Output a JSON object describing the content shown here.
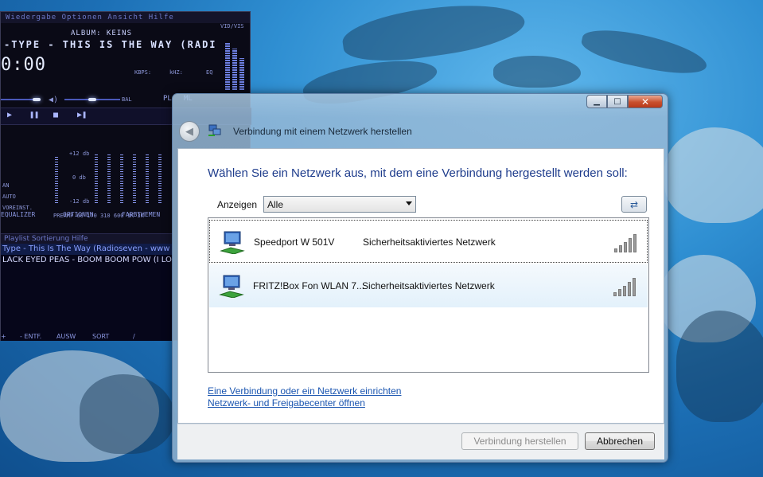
{
  "player": {
    "menu": "Wiedergabe  Optionen  Ansicht  Hilfe",
    "album": "ALBUM: KEINS",
    "title": "-TYPE - THIS IS THE WAY   (RADI",
    "time": "0:00",
    "kbps": "KBPS:",
    "khz": "kHZ:",
    "eq_btn": "EQ",
    "bal": "BAL",
    "pl": "PL",
    "ml": "ML",
    "vidvis": "VID/VIS",
    "eq_labels": [
      "EQUALIZER",
      "OPTIONEN",
      "FARBTHEMEN"
    ],
    "eq_side": [
      "AN",
      "AUTO",
      "VOREINST."
    ],
    "eq_db": [
      "+12 db",
      "0 db",
      "-12 db"
    ],
    "eq_freq": "PREAMP  60  170  310  600  1K  3K",
    "playlist_menu": "Playlist  Sortierung  Hilfe",
    "playlist_rows": [
      "Type - This Is The Way  (Radioseven - www",
      "LACK EYED PEAS - BOOM BOOM POW (I LO"
    ],
    "playlist_footer": [
      "+",
      "- ENTF.",
      "AUSW",
      "SORT",
      "/"
    ]
  },
  "dialog": {
    "title": "Verbindung mit einem Netzwerk herstellen",
    "instruction": "Wählen Sie ein Netzwerk aus, mit dem eine Verbindung hergestellt werden soll:",
    "filter_label": "Anzeigen",
    "filter_value": "Alle",
    "networks": [
      {
        "name": "Speedport W 501V",
        "security": "Sicherheitsaktiviertes Netzwerk",
        "signal_bars": 5
      },
      {
        "name": "FRITZ!Box Fon WLAN 7...",
        "security": "Sicherheitsaktiviertes Netzwerk",
        "signal_bars": 5
      }
    ],
    "link_setup": "Eine Verbindung oder ein Netzwerk einrichten",
    "link_center": "Netzwerk- und Freigabecenter öffnen",
    "connect_label": "Verbindung herstellen",
    "cancel_label": "Abbrechen"
  },
  "colors": {
    "instruction": "#1e3c8c",
    "link": "#1a55b0",
    "close": "#c9502e",
    "selected_row": "#e3f1fb"
  }
}
